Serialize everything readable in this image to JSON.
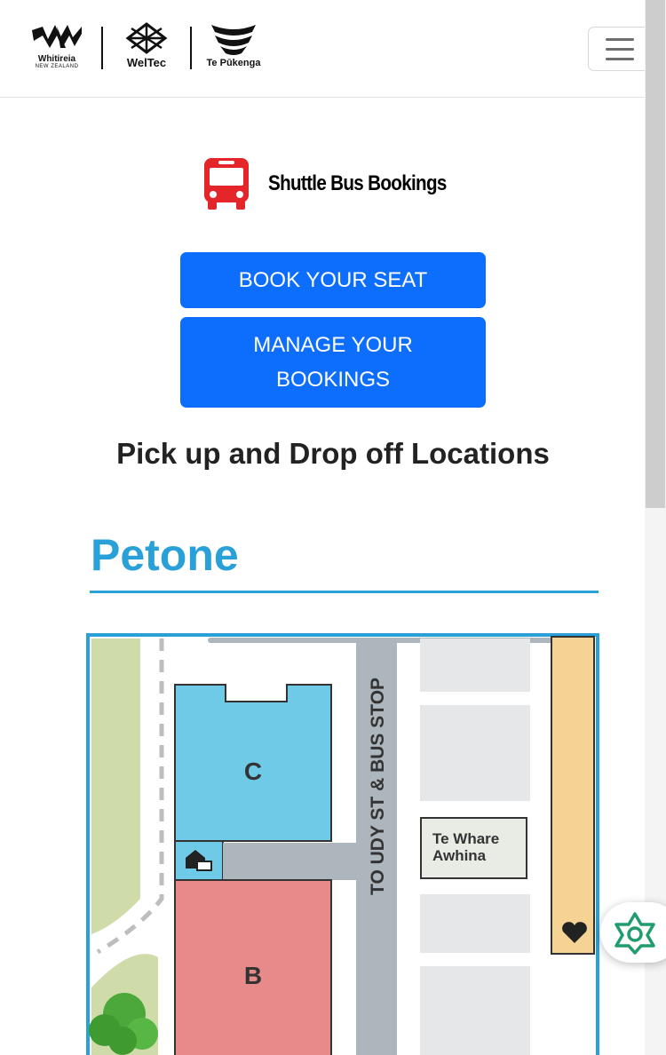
{
  "header": {
    "logos": [
      {
        "name": "Whitireia",
        "sub": "NEW ZEALAND"
      },
      {
        "name": "WelTec"
      },
      {
        "name": "Te Pūkenga"
      }
    ],
    "menu_icon": "hamburger-icon"
  },
  "brand": {
    "icon": "bus-icon",
    "icon_color": "#e4262b",
    "title": "Shuttle Bus Bookings"
  },
  "actions": {
    "book_label": "BOOK YOUR SEAT",
    "manage_label": "MANAGE YOUR BOOKINGS",
    "accent": "#0d6efd"
  },
  "locations": {
    "heading": "Pick up and Drop off Locations",
    "map": {
      "campus": "Petone",
      "street_label": "TO UDY ST & BUS STOP",
      "buildings": [
        "C",
        "B"
      ],
      "landmark": "Te Whare Awhina",
      "icons": [
        "home-office-icon",
        "heart-health-icon",
        "tree-icon"
      ]
    }
  },
  "chat": {
    "icon": "ai-assistant-icon"
  }
}
